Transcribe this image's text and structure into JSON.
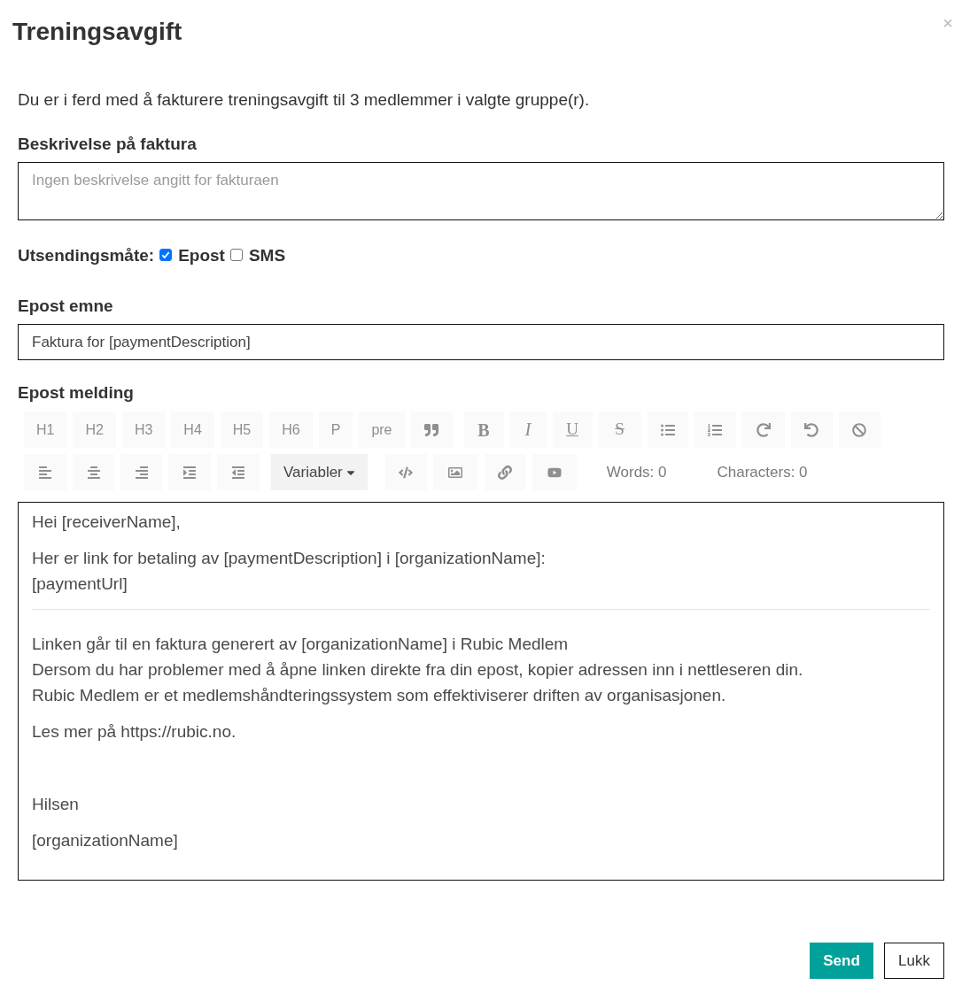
{
  "dialog": {
    "title": "Treningsavgift",
    "close": "×"
  },
  "intro": "Du er i ferd med å fakturere treningsavgift til 3 medlemmer i valgte gruppe(r).",
  "description": {
    "label": "Beskrivelse på faktura",
    "placeholder": "Ingen beskrivelse angitt for fakturaen"
  },
  "delivery": {
    "label": "Utsendingsmåte:",
    "options": [
      {
        "label": "Epost",
        "checked": true
      },
      {
        "label": "SMS",
        "checked": false
      }
    ]
  },
  "subject": {
    "label": "Epost emne",
    "value": "Faktura for [paymentDescription]"
  },
  "message": {
    "label": "Epost melding",
    "toolbar": [
      {
        "groups": [
          [
            {
              "kind": "text",
              "label": "H1",
              "disabled": true
            },
            {
              "kind": "text",
              "label": "H2",
              "disabled": true
            },
            {
              "kind": "text",
              "label": "H3",
              "disabled": true
            },
            {
              "kind": "text",
              "label": "H4",
              "disabled": true
            },
            {
              "kind": "text",
              "label": "H5",
              "disabled": true
            },
            {
              "kind": "text",
              "label": "H6",
              "disabled": true
            },
            {
              "kind": "text",
              "label": "P",
              "disabled": true
            },
            {
              "kind": "text",
              "label": "pre",
              "disabled": true
            },
            {
              "kind": "quote",
              "disabled": true
            }
          ],
          [
            {
              "kind": "bold",
              "label": "B",
              "disabled": true
            },
            {
              "kind": "italic",
              "label": "I",
              "disabled": true
            },
            {
              "kind": "underline",
              "label": "U",
              "disabled": true
            },
            {
              "kind": "strike",
              "label": "S",
              "disabled": true
            },
            {
              "kind": "bullets",
              "disabled": true
            },
            {
              "kind": "numbers",
              "disabled": true
            },
            {
              "kind": "redo",
              "disabled": true
            },
            {
              "kind": "undo",
              "disabled": true
            },
            {
              "kind": "clear",
              "disabled": true
            }
          ]
        ]
      },
      {
        "groups": [
          [
            {
              "kind": "left",
              "disabled": true
            },
            {
              "kind": "center",
              "disabled": true
            },
            {
              "kind": "right",
              "disabled": true
            },
            {
              "kind": "indent",
              "disabled": true
            },
            {
              "kind": "outdent",
              "disabled": true
            }
          ],
          [
            {
              "kind": "dropdown",
              "label": "Variabler",
              "disabled": false
            }
          ],
          [
            {
              "kind": "code",
              "disabled": true
            },
            {
              "kind": "image",
              "disabled": true
            },
            {
              "kind": "link",
              "disabled": true
            },
            {
              "kind": "video",
              "disabled": true
            }
          ]
        ]
      }
    ],
    "counters": [
      "Words: 0",
      "Characters: 0"
    ],
    "body": [
      {
        "kind": "paragraph",
        "lines": [
          "Hei [receiverName],"
        ]
      },
      {
        "kind": "paragraph",
        "lines": [
          "Her er link for betaling av [paymentDescription] i [organizationName]:",
          "[paymentUrl]"
        ]
      },
      {
        "kind": "rule"
      },
      {
        "kind": "paragraph",
        "lines": [
          "Linken går til en faktura generert av [organizationName] i Rubic Medlem",
          "Dersom du har problemer med å åpne linken direkte fra din epost, kopier adressen inn i nettleseren din.",
          "Rubic Medlem er et medlemshåndteringssystem som effektiviserer driften av organisasjonen."
        ]
      },
      {
        "kind": "paragraph",
        "lines": [
          "Les mer på https://rubic.no."
        ]
      },
      {
        "kind": "blank"
      },
      {
        "kind": "paragraph",
        "lines": [
          "Hilsen"
        ]
      },
      {
        "kind": "paragraph",
        "lines": [
          "[organizationName]"
        ]
      }
    ]
  },
  "buttons": [
    {
      "kind": "primary",
      "label": "Send"
    },
    {
      "kind": "secondary",
      "label": "Lukk"
    }
  ]
}
